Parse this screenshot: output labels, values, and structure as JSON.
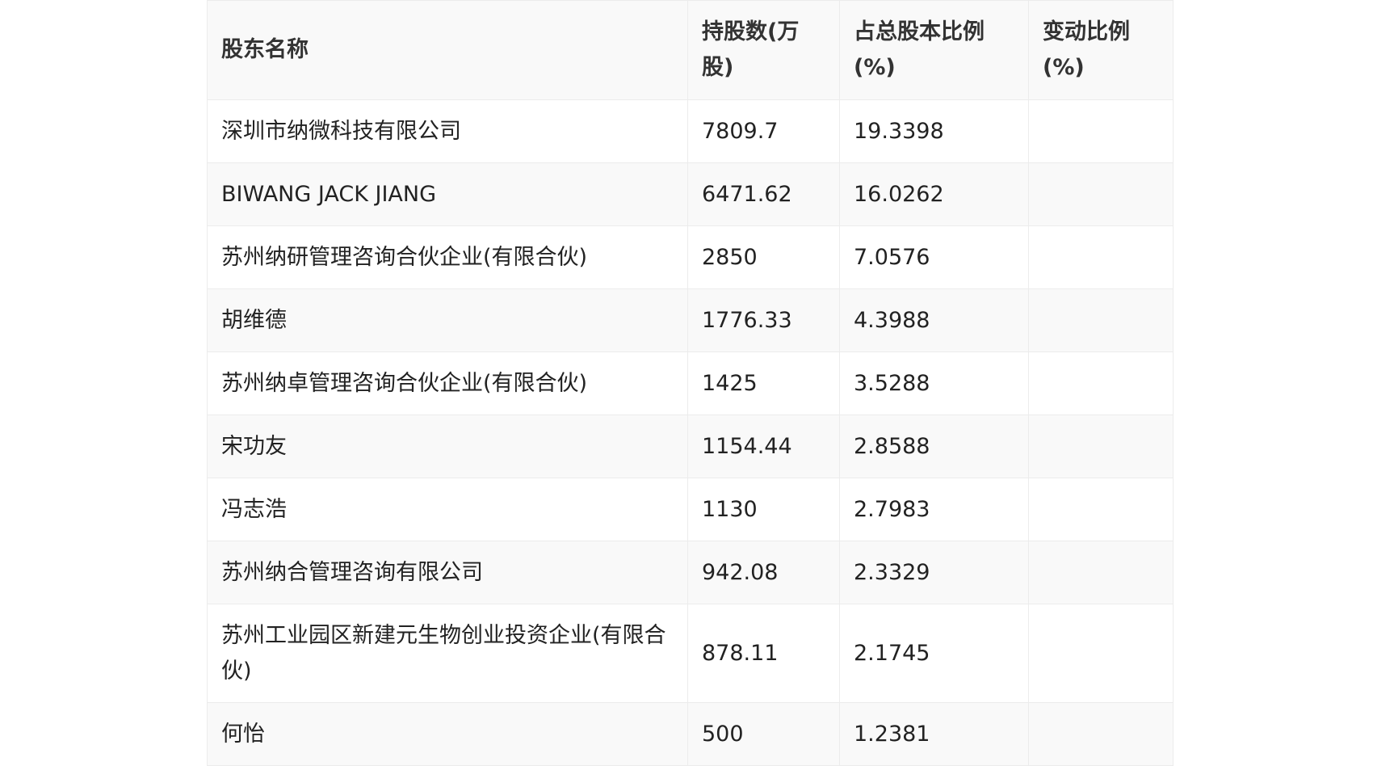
{
  "table": {
    "headers": [
      "股东名称",
      "持股数(万股)",
      "占总股本比例(%)",
      "变动比例(%)"
    ],
    "rows": [
      [
        "深圳市纳微科技有限公司",
        "7809.7",
        "19.3398",
        ""
      ],
      [
        "BIWANG JACK JIANG",
        "6471.62",
        "16.0262",
        ""
      ],
      [
        "苏州纳研管理咨询合伙企业(有限合伙)",
        "2850",
        "7.0576",
        ""
      ],
      [
        "胡维德",
        "1776.33",
        "4.3988",
        ""
      ],
      [
        "苏州纳卓管理咨询合伙企业(有限合伙)",
        "1425",
        "3.5288",
        ""
      ],
      [
        "宋功友",
        "1154.44",
        "2.8588",
        ""
      ],
      [
        "冯志浩",
        "1130",
        "2.7983",
        ""
      ],
      [
        "苏州纳合管理咨询有限公司",
        "942.08",
        "2.3329",
        ""
      ],
      [
        "苏州工业园区新建元生物创业投资企业(有限合伙)",
        "878.11",
        "2.1745",
        ""
      ],
      [
        "何怡",
        "500",
        "1.2381",
        ""
      ]
    ]
  }
}
